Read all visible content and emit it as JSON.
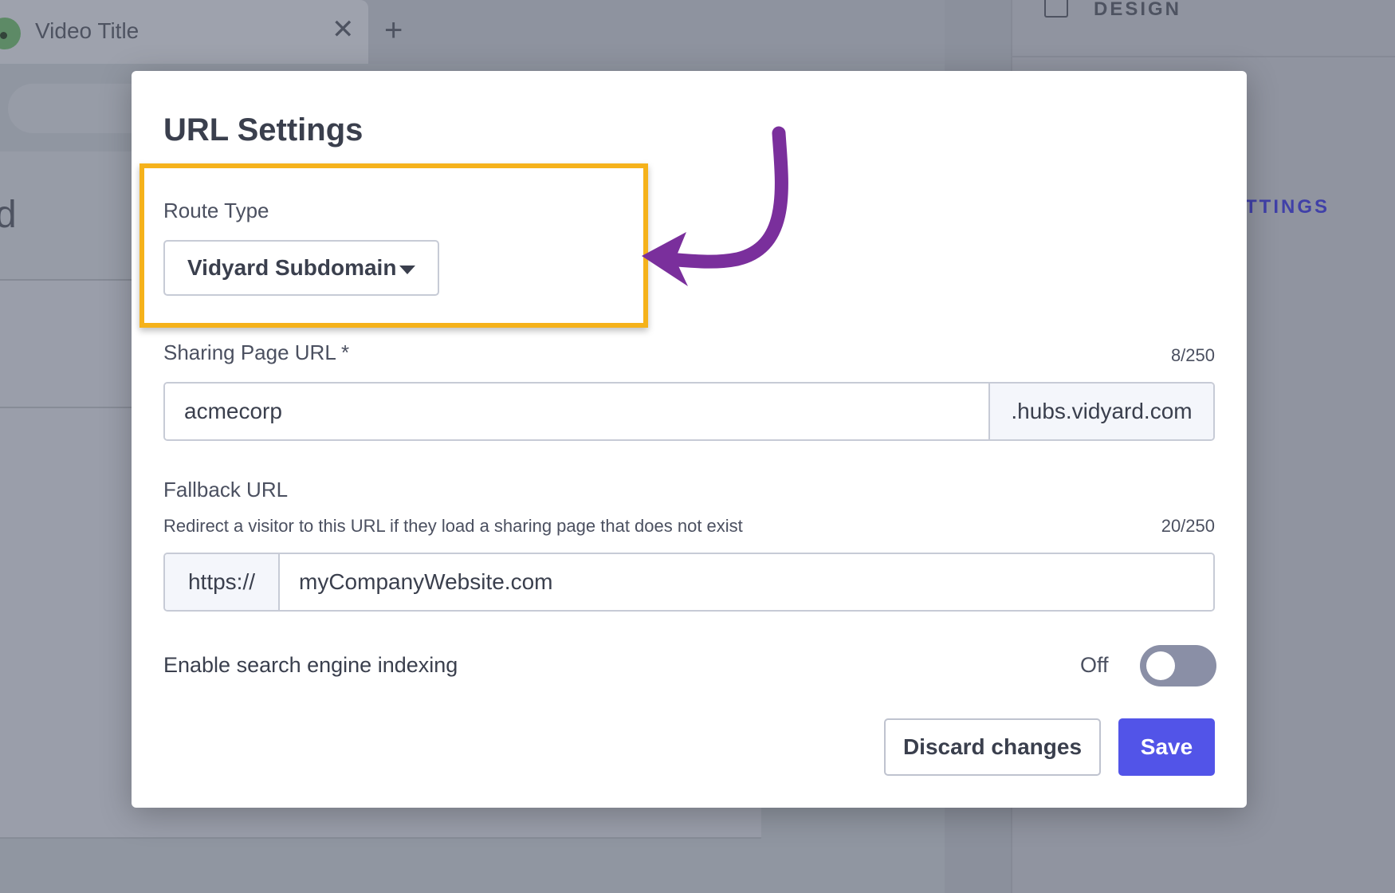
{
  "background": {
    "tab": {
      "title": "Video Title",
      "close_glyph": "✕",
      "add_glyph": "+"
    },
    "left_partial_text": "d",
    "right_panel": {
      "design_label": "DESIGN",
      "settings_label": "TTINGS"
    }
  },
  "modal": {
    "title": "URL Settings",
    "route_type": {
      "label": "Route Type",
      "value": "Vidyard Subdomain"
    },
    "sharing_url": {
      "label": "Sharing Page URL *",
      "count": "8/250",
      "value": "acmecorp",
      "suffix": ".hubs.vidyard.com"
    },
    "fallback_url": {
      "label": "Fallback URL",
      "description": "Redirect a visitor to this URL if they load a sharing page that does not exist",
      "count": "20/250",
      "prefix": "https://",
      "value": "myCompanyWebsite.com"
    },
    "indexing": {
      "label": "Enable search engine indexing",
      "state": "Off",
      "enabled": false
    },
    "buttons": {
      "discard": "Discard changes",
      "save": "Save"
    }
  },
  "annotation": {
    "highlight_color": "#f5b21b",
    "arrow_color": "#7a2f9c"
  },
  "colors": {
    "accent": "#5254e8"
  }
}
